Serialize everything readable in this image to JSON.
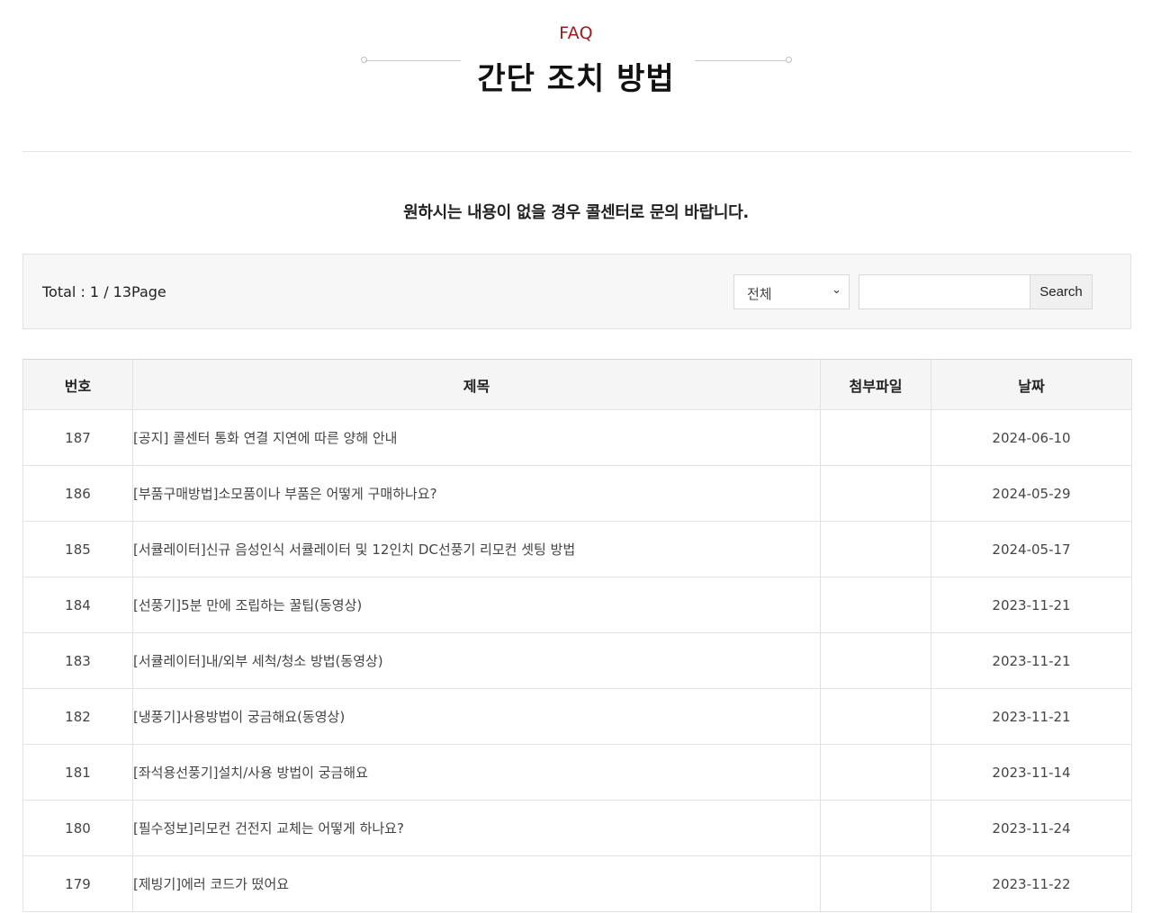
{
  "header": {
    "kicker": "FAQ",
    "title": "간단 조치 방법"
  },
  "notice": "원하시는 내용이 없을 경우 콜센터로 문의 바랍니다.",
  "search": {
    "total_text": "Total : 1 / 13Page",
    "category_selected": "전체",
    "input_value": "",
    "button_label": "Search"
  },
  "table": {
    "headers": [
      "번호",
      "제목",
      "첨부파일",
      "날짜"
    ],
    "rows": [
      {
        "num": "187",
        "title": "[공지] 콜센터 통화 연결 지연에 따른 양해 안내",
        "attachment": "",
        "date": "2024-06-10"
      },
      {
        "num": "186",
        "title": "[부품구매방법]소모품이나 부품은 어떻게 구매하나요?",
        "attachment": "",
        "date": "2024-05-29"
      },
      {
        "num": "185",
        "title": "[서큘레이터]신규 음성인식 서큘레이터 및 12인치 DC선풍기 리모컨 셋팅 방법",
        "attachment": "",
        "date": "2024-05-17"
      },
      {
        "num": "184",
        "title": "[선풍기]5분 만에 조립하는 꿀팁(동영상)",
        "attachment": "",
        "date": "2023-11-21"
      },
      {
        "num": "183",
        "title": "[서큘레이터]내/외부 세척/청소 방법(동영상)",
        "attachment": "",
        "date": "2023-11-21"
      },
      {
        "num": "182",
        "title": "[냉풍기]사용방법이 궁금해요(동영상)",
        "attachment": "",
        "date": "2023-11-21"
      },
      {
        "num": "181",
        "title": "[좌석용선풍기]설치/사용 방법이 궁금해요",
        "attachment": "",
        "date": "2023-11-14"
      },
      {
        "num": "180",
        "title": "[필수정보]리모컨 건전지 교체는 어떻게 하나요?",
        "attachment": "",
        "date": "2023-11-24"
      },
      {
        "num": "179",
        "title": "[제빙기]에러 코드가 떴어요",
        "attachment": "",
        "date": "2023-11-22"
      }
    ]
  },
  "colors": {
    "accent": "#9b1b1f",
    "table_top_border": "#a4343a",
    "header_bg": "#f5f5f5",
    "search_bar_bg": "#f7f7f7"
  }
}
